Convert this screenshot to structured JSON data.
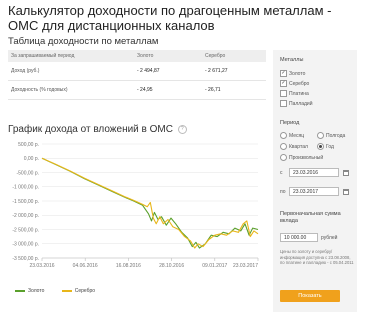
{
  "title": "Калькулятор доходности по драгоценным металлам - ОМС для дистанционных каналов",
  "table": {
    "heading": "Таблица доходности по металлам",
    "columns": [
      "За запрашиваемый период",
      "Золото",
      "Серебро"
    ],
    "rows": [
      {
        "label": "Доход (руб.)",
        "gold": "- 2 494,87",
        "silver": "- 2 671,27"
      },
      {
        "label": "Доходность (% годовых)",
        "gold": "- 24,95",
        "silver": "- 26,71"
      }
    ]
  },
  "chart_heading": "График дохода от вложений в ОМС",
  "chart_data": {
    "type": "line",
    "x_ticks": [
      "23.03.2016",
      "04.06.2016",
      "16.08.2016",
      "28.10.2016",
      "09.01.2017",
      "23.03.2017"
    ],
    "y_ticks": [
      "500,00 р.",
      "0,00 р.",
      "-500,00 р.",
      "-1 000,00 р.",
      "-1 500,00 р.",
      "-2 000,00 р.",
      "-2 500,00 р.",
      "-3 000,00 р.",
      "-3 500,00 р."
    ],
    "ylim": [
      -3500,
      500
    ],
    "xlim": [
      0,
      365
    ],
    "series": [
      {
        "name": "Золото",
        "color": "#5aa02c",
        "points": [
          [
            0,
            0
          ],
          [
            24,
            -230
          ],
          [
            48,
            -460
          ],
          [
            72,
            -720
          ],
          [
            96,
            -950
          ],
          [
            120,
            -1180
          ],
          [
            140,
            -1370
          ],
          [
            155,
            -1500
          ],
          [
            170,
            -1650
          ],
          [
            180,
            -1950
          ],
          [
            185,
            -2200
          ],
          [
            190,
            -1900
          ],
          [
            196,
            -2150
          ],
          [
            202,
            -2050
          ],
          [
            210,
            -2350
          ],
          [
            218,
            -2100
          ],
          [
            226,
            -2300
          ],
          [
            236,
            -2600
          ],
          [
            246,
            -2800
          ],
          [
            254,
            -3100
          ],
          [
            260,
            -2950
          ],
          [
            266,
            -3150
          ],
          [
            276,
            -3000
          ],
          [
            286,
            -2700
          ],
          [
            296,
            -2750
          ],
          [
            306,
            -2600
          ],
          [
            316,
            -2650
          ],
          [
            326,
            -2450
          ],
          [
            336,
            -2550
          ],
          [
            343,
            -2300
          ],
          [
            350,
            -2700
          ],
          [
            356,
            -2450
          ],
          [
            365,
            -2500
          ]
        ]
      },
      {
        "name": "Серебро",
        "color": "#e8b61a",
        "points": [
          [
            0,
            0
          ],
          [
            24,
            -220
          ],
          [
            48,
            -450
          ],
          [
            72,
            -700
          ],
          [
            96,
            -930
          ],
          [
            120,
            -1160
          ],
          [
            140,
            -1350
          ],
          [
            155,
            -1480
          ],
          [
            170,
            -1620
          ],
          [
            178,
            -1700
          ],
          [
            183,
            -1550
          ],
          [
            188,
            -2100
          ],
          [
            193,
            -2300
          ],
          [
            199,
            -2050
          ],
          [
            205,
            -2300
          ],
          [
            213,
            -2150
          ],
          [
            221,
            -2400
          ],
          [
            231,
            -2500
          ],
          [
            241,
            -2750
          ],
          [
            251,
            -2900
          ],
          [
            258,
            -3150
          ],
          [
            264,
            -3000
          ],
          [
            272,
            -3100
          ],
          [
            282,
            -2850
          ],
          [
            292,
            -2700
          ],
          [
            302,
            -2650
          ],
          [
            312,
            -2700
          ],
          [
            322,
            -2550
          ],
          [
            332,
            -2600
          ],
          [
            340,
            -2300
          ],
          [
            346,
            -2200
          ],
          [
            352,
            -2750
          ],
          [
            358,
            -2550
          ],
          [
            365,
            -2650
          ]
        ]
      }
    ],
    "legend": [
      "Золото",
      "Серебро"
    ]
  },
  "sidebar": {
    "metals_title": "Металлы",
    "metals": [
      {
        "label": "Золото",
        "checked": true
      },
      {
        "label": "Серебро",
        "checked": true
      },
      {
        "label": "Платина",
        "checked": false
      },
      {
        "label": "Палладий",
        "checked": false
      }
    ],
    "period_title": "Период",
    "periods": [
      {
        "label": "Месяц",
        "selected": false
      },
      {
        "label": "Полгода",
        "selected": false
      },
      {
        "label": "Квартал",
        "selected": false
      },
      {
        "label": "Год",
        "selected": true
      },
      {
        "label": "Произвольный",
        "selected": false
      }
    ],
    "from_label": "с",
    "from_value": "23.03.2016",
    "to_label": "по",
    "to_value": "23.03.2017",
    "amount_title": "Первоначальная сумма вклада",
    "amount_value": "10 000.00",
    "amount_unit": "рублей",
    "note": "Цены по золоту и серебру/информация доступна с 23.08.2008, по платине и палладию - с 05.04.2011",
    "show_button": "Показать"
  }
}
